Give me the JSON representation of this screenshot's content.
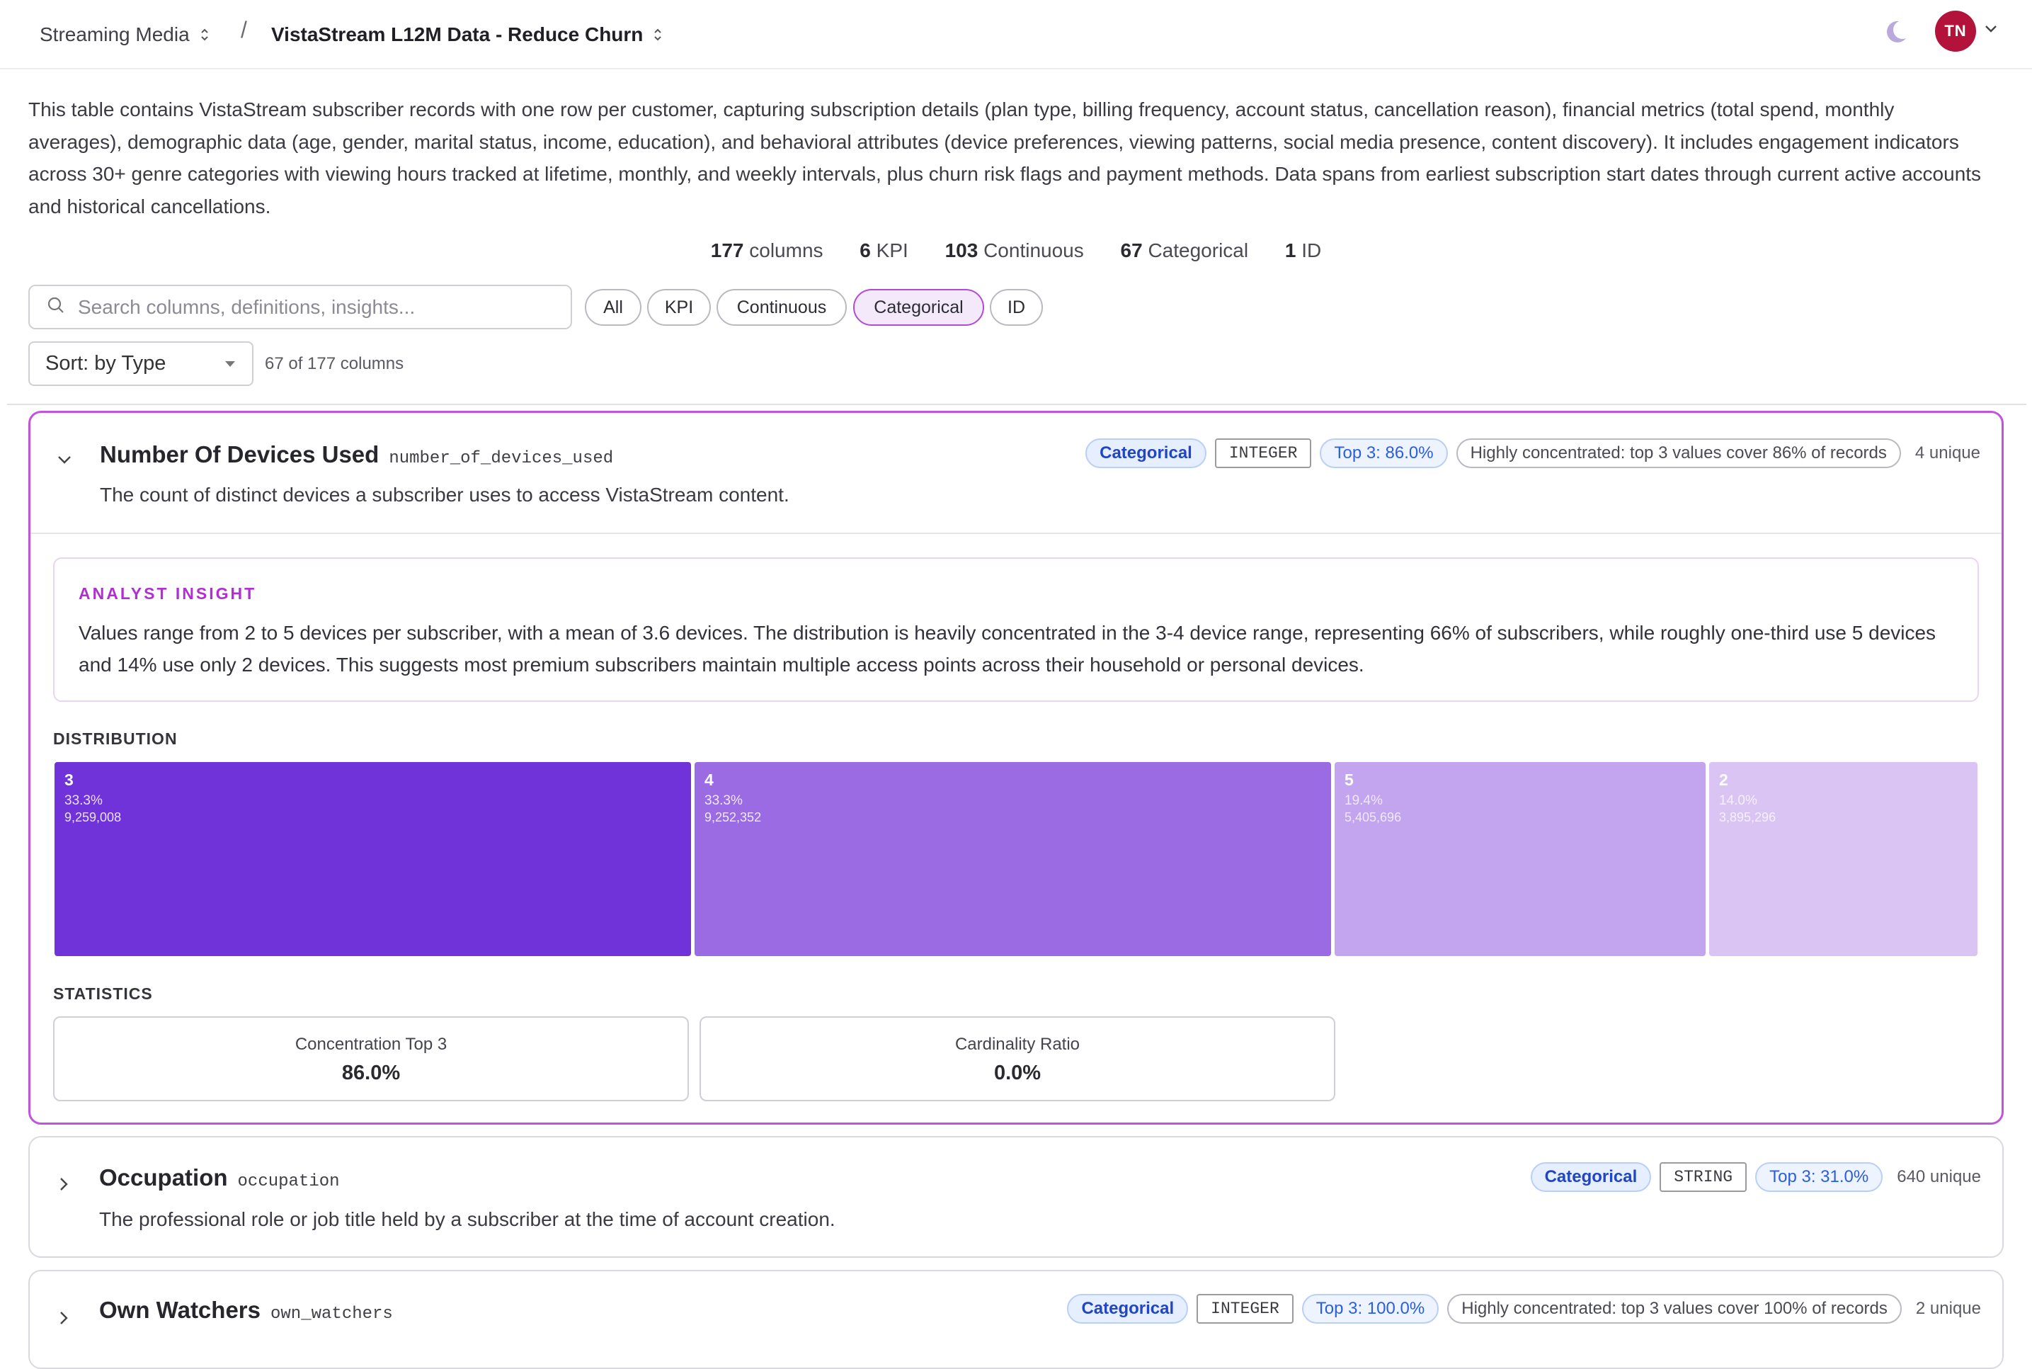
{
  "header": {
    "workspace": "Streaming Media",
    "separator": "/",
    "dataset": "VistaStream L12M Data - Reduce Churn",
    "avatar_initials": "TN"
  },
  "description": "This table contains VistaStream subscriber records with one row per customer, capturing subscription details (plan type, billing frequency, account status, cancellation reason), financial metrics (total spend, monthly averages), demographic data (age, gender, marital status, income, education), and behavioral attributes (device preferences, viewing patterns, social media presence, content discovery). It includes engagement indicators across 30+ genre categories with viewing hours tracked at lifetime, monthly, and weekly intervals, plus churn risk flags and payment methods. Data spans from earliest subscription start dates through current active accounts and historical cancellations.",
  "summary": [
    {
      "count": "177",
      "label": "columns"
    },
    {
      "count": "6",
      "label": "KPI"
    },
    {
      "count": "103",
      "label": "Continuous"
    },
    {
      "count": "67",
      "label": "Categorical"
    },
    {
      "count": "1",
      "label": "ID"
    }
  ],
  "search": {
    "placeholder": "Search columns, definitions, insights...",
    "value": ""
  },
  "filters": [
    {
      "label": "All",
      "active": false
    },
    {
      "label": "KPI",
      "active": false
    },
    {
      "label": "Continuous",
      "active": false
    },
    {
      "label": "Categorical",
      "active": true
    },
    {
      "label": "ID",
      "active": false
    }
  ],
  "sort": {
    "label": "Sort: by Type"
  },
  "column_count": "67 of 177 columns",
  "columns": [
    {
      "title": "Number Of Devices Used",
      "code": "number_of_devices_used",
      "description": "The count of distinct devices a subscriber uses to access VistaStream content.",
      "type_badge": "Categorical",
      "dtype_badge": "INTEGER",
      "top_badge": "Top 3: 86.0%",
      "note_badge": "Highly concentrated: top 3 values cover 86% of records",
      "unique": "4 unique",
      "expanded": true,
      "insight_label": "ANALYST INSIGHT",
      "insight": "Values range from 2 to 5 devices per subscriber, with a mean of 3.6 devices. The distribution is heavily concentrated in the 3-4 device range, representing 66% of subscribers, while roughly one-third use 5 devices and 14% use only 2 devices. This suggests most premium subscribers maintain multiple access points across their household or personal devices.",
      "distribution_label": "DISTRIBUTION",
      "distribution": [
        {
          "value": "3",
          "pct": "33.3%",
          "count": "9,259,008",
          "share": 33.3,
          "color": "#6f33d9"
        },
        {
          "value": "4",
          "pct": "33.3%",
          "count": "9,252,352",
          "share": 33.3,
          "color": "#9b6be3"
        },
        {
          "value": "5",
          "pct": "19.4%",
          "count": "5,405,696",
          "share": 19.4,
          "color": "#c3a4ee"
        },
        {
          "value": "2",
          "pct": "14.0%",
          "count": "3,895,296",
          "share": 14.0,
          "color": "#d9c4f4"
        }
      ],
      "statistics_label": "STATISTICS",
      "statistics": [
        {
          "label": "Concentration Top 3",
          "value": "86.0%"
        },
        {
          "label": "Cardinality Ratio",
          "value": "0.0%"
        }
      ]
    },
    {
      "title": "Occupation",
      "code": "occupation",
      "description": "The professional role or job title held by a subscriber at the time of account creation.",
      "type_badge": "Categorical",
      "dtype_badge": "STRING",
      "top_badge": "Top 3: 31.0%",
      "unique": "640 unique",
      "expanded": false
    },
    {
      "title": "Own Watchers",
      "code": "own_watchers",
      "type_badge": "Categorical",
      "dtype_badge": "INTEGER",
      "top_badge": "Top 3: 100.0%",
      "note_badge": "Highly concentrated: top 3 values cover 100% of records",
      "unique": "2 unique",
      "expanded": false
    }
  ],
  "colors": {
    "accent": "#c154dc",
    "insight_label": "#b12fd2",
    "avatar": "#b3123a",
    "type_badge": "#2145c4"
  },
  "icons": [
    "chevron-updown-icon",
    "moon-icon",
    "chevron-down-icon",
    "search-icon",
    "caret-down-icon",
    "chevron-right-icon"
  ]
}
